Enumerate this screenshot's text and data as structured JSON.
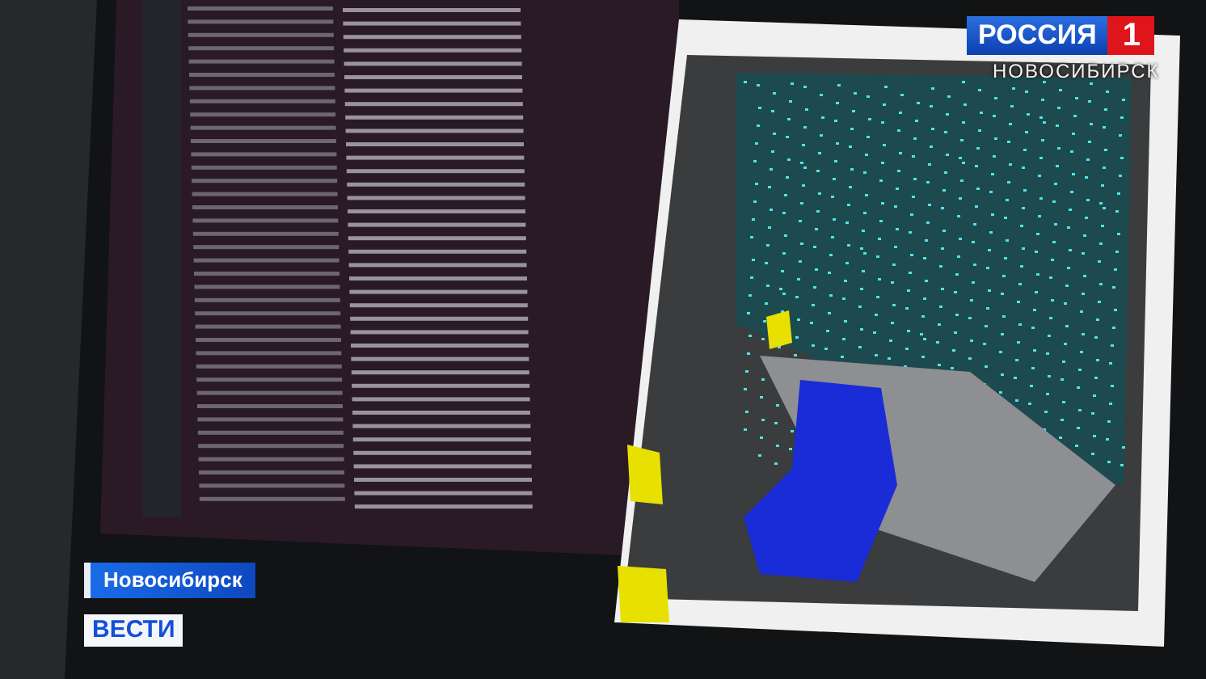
{
  "channel_logo": {
    "name": "РОССИЯ",
    "number": "1",
    "region": "НОВОСИБИРСК"
  },
  "caption": {
    "location": "Новосибирск",
    "program": "ВЕСТИ"
  }
}
